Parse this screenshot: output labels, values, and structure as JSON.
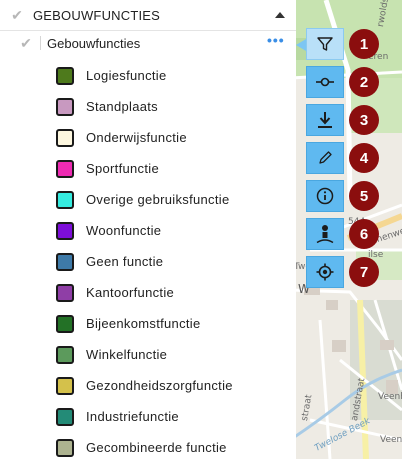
{
  "panel": {
    "header_title": "GEBOUWFUNCTIES",
    "sublayer_title": "Gebouwfuncties",
    "more_label": "•••",
    "check_glyph": "✔"
  },
  "legend": [
    {
      "label": "Logiesfunctie",
      "color": "#4e7a1c"
    },
    {
      "label": "Standplaats",
      "color": "#c899c0"
    },
    {
      "label": "Onderwijsfunctie",
      "color": "#fdf7df"
    },
    {
      "label": "Sportfunctie",
      "color": "#ee2bb3"
    },
    {
      "label": "Overige gebruiksfunctie",
      "color": "#35ece0"
    },
    {
      "label": "Woonfunctie",
      "color": "#7d0ed9"
    },
    {
      "label": "Geen functie",
      "color": "#3e7aa8"
    },
    {
      "label": "Kantoorfunctie",
      "color": "#8f3ea6"
    },
    {
      "label": "Bijeenkomstfunctie",
      "color": "#237126"
    },
    {
      "label": "Winkelfunctie",
      "color": "#5c9a5c"
    },
    {
      "label": "Gezondheidszorgfunctie",
      "color": "#d4c14b"
    },
    {
      "label": "Industriefunctie",
      "color": "#238b77"
    },
    {
      "label": "Gecombineerde functie",
      "color": "#adb390"
    }
  ],
  "toolbar": [
    {
      "name": "filter",
      "icon": "filter-icon",
      "badge": "1",
      "active": true
    },
    {
      "name": "commit",
      "icon": "commit-icon",
      "badge": "2",
      "active": false
    },
    {
      "name": "download",
      "icon": "download-icon",
      "badge": "3",
      "active": false
    },
    {
      "name": "edit",
      "icon": "pencil-icon",
      "badge": "4",
      "active": false
    },
    {
      "name": "info",
      "icon": "info-icon",
      "badge": "5",
      "active": false
    },
    {
      "name": "person",
      "icon": "person-icon",
      "badge": "6",
      "active": false
    },
    {
      "name": "locate",
      "icon": "locate-icon",
      "badge": "7",
      "active": false
    }
  ],
  "map": {
    "labels": [
      "rwoldse",
      "eren",
      "Binnenweg",
      "544",
      "ilse",
      "Twello",
      "W",
      "Veenh",
      "Veenhu",
      "Twelose Beek",
      "straat",
      "andstraat"
    ]
  },
  "colors": {
    "tool_bg": "#5fb9f0",
    "tool_active_bg": "#b9e0f8",
    "badge_bg": "#8b0e0e"
  }
}
